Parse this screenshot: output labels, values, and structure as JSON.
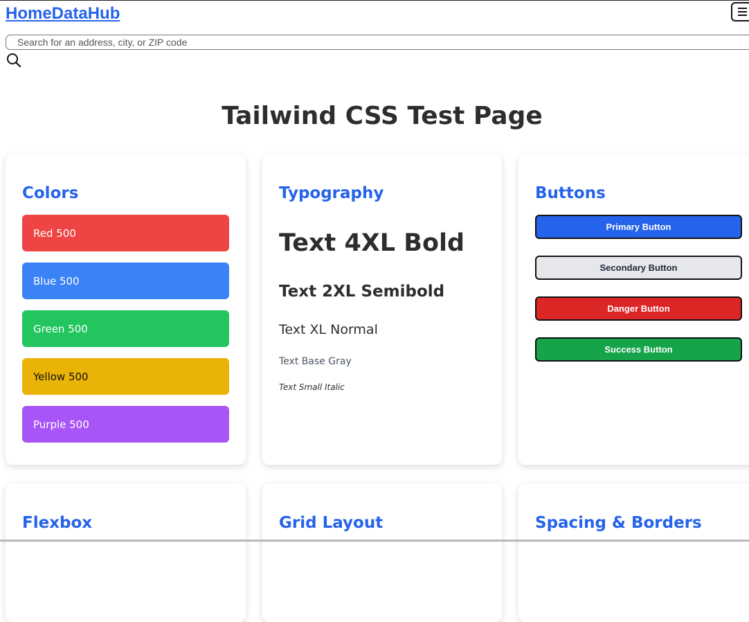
{
  "header": {
    "brand": "HomeDataHub",
    "search_placeholder": "Search for an address, city, or ZIP code"
  },
  "page_title": "Tailwind CSS Test Page",
  "cards": {
    "colors": {
      "title": "Colors",
      "swatches": [
        {
          "label": "Red 500",
          "color": "#ef4444"
        },
        {
          "label": "Blue 500",
          "color": "#3b82f6"
        },
        {
          "label": "Green 500",
          "color": "#22c55e"
        },
        {
          "label": "Yellow 500",
          "color": "#eab308"
        },
        {
          "label": "Purple 500",
          "color": "#a855f7"
        }
      ]
    },
    "typography": {
      "title": "Typography",
      "samples": [
        "Text 4XL Bold",
        "Text 2XL Semibold",
        "Text XL Normal",
        "Text Base Gray",
        "Text Small Italic"
      ]
    },
    "buttons": {
      "title": "Buttons",
      "items": [
        {
          "label": "Primary Button",
          "bg": "#2563eb",
          "fg": "#ffffff"
        },
        {
          "label": "Secondary Button",
          "bg": "#e5e7eb",
          "fg": "#1f2937"
        },
        {
          "label": "Danger Button",
          "bg": "#dc2626",
          "fg": "#ffffff"
        },
        {
          "label": "Success Button",
          "bg": "#16a34a",
          "fg": "#ffffff"
        }
      ]
    },
    "flexbox": {
      "title": "Flexbox"
    },
    "grid": {
      "title": "Grid Layout"
    },
    "spacing": {
      "title": "Spacing & Borders"
    }
  },
  "colors": {
    "accent": "#2563eb",
    "heading": "#2d2d2d"
  }
}
